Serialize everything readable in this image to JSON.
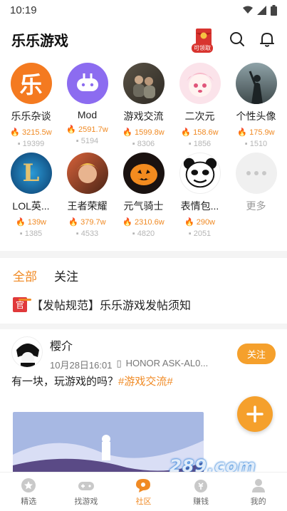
{
  "status": {
    "time": "10:19"
  },
  "header": {
    "title": "乐乐游戏",
    "gift_badge": "可领取"
  },
  "categories": [
    {
      "name": "乐乐杂谈",
      "heat": "3215.5w",
      "comments": "19399",
      "icon": "le-logo-icon"
    },
    {
      "name": "Mod",
      "heat": "2591.7w",
      "comments": "5194",
      "icon": "gamepad-icon"
    },
    {
      "name": "游戏交流",
      "heat": "1599.8w",
      "comments": "8306",
      "icon": "friends-photo"
    },
    {
      "name": "二次元",
      "heat": "158.6w",
      "comments": "1856",
      "icon": "anime-girl-photo"
    },
    {
      "name": "个性头像",
      "heat": "175.9w",
      "comments": "1510",
      "icon": "silhouette-photo"
    },
    {
      "name": "LOL英...",
      "heat": "139w",
      "comments": "1385",
      "icon": "lol-logo-icon"
    },
    {
      "name": "王者荣耀",
      "heat": "379.7w",
      "comments": "4533",
      "icon": "hero-photo"
    },
    {
      "name": "元气骑士",
      "heat": "2310.6w",
      "comments": "4820",
      "icon": "pumpkin-photo"
    },
    {
      "name": "表情包...",
      "heat": "290w",
      "comments": "2051",
      "icon": "panda-meme-photo"
    },
    {
      "name": "更多",
      "heat": "",
      "comments": "",
      "icon": "more-icon"
    }
  ],
  "tabs": [
    "全部",
    "关注"
  ],
  "notice": {
    "tag": "官",
    "text": "【发帖规范】乐乐游戏发帖须知"
  },
  "post": {
    "user": "樱介",
    "time": "10月28日16:01",
    "device": "HONOR ASK-AL0...",
    "follow": "关注",
    "text": "有一块，玩游戏的吗？",
    "hashtag": "#游戏交流#"
  },
  "nav": [
    {
      "label": "精选",
      "active": false
    },
    {
      "label": "找游戏",
      "active": false
    },
    {
      "label": "社区",
      "active": true
    },
    {
      "label": "赚钱",
      "active": false
    },
    {
      "label": "我的",
      "active": false
    }
  ],
  "watermark": "289.com",
  "colors": {
    "accent": "#f08a24",
    "heat": "#f08a24",
    "tag": "#e0393b"
  }
}
